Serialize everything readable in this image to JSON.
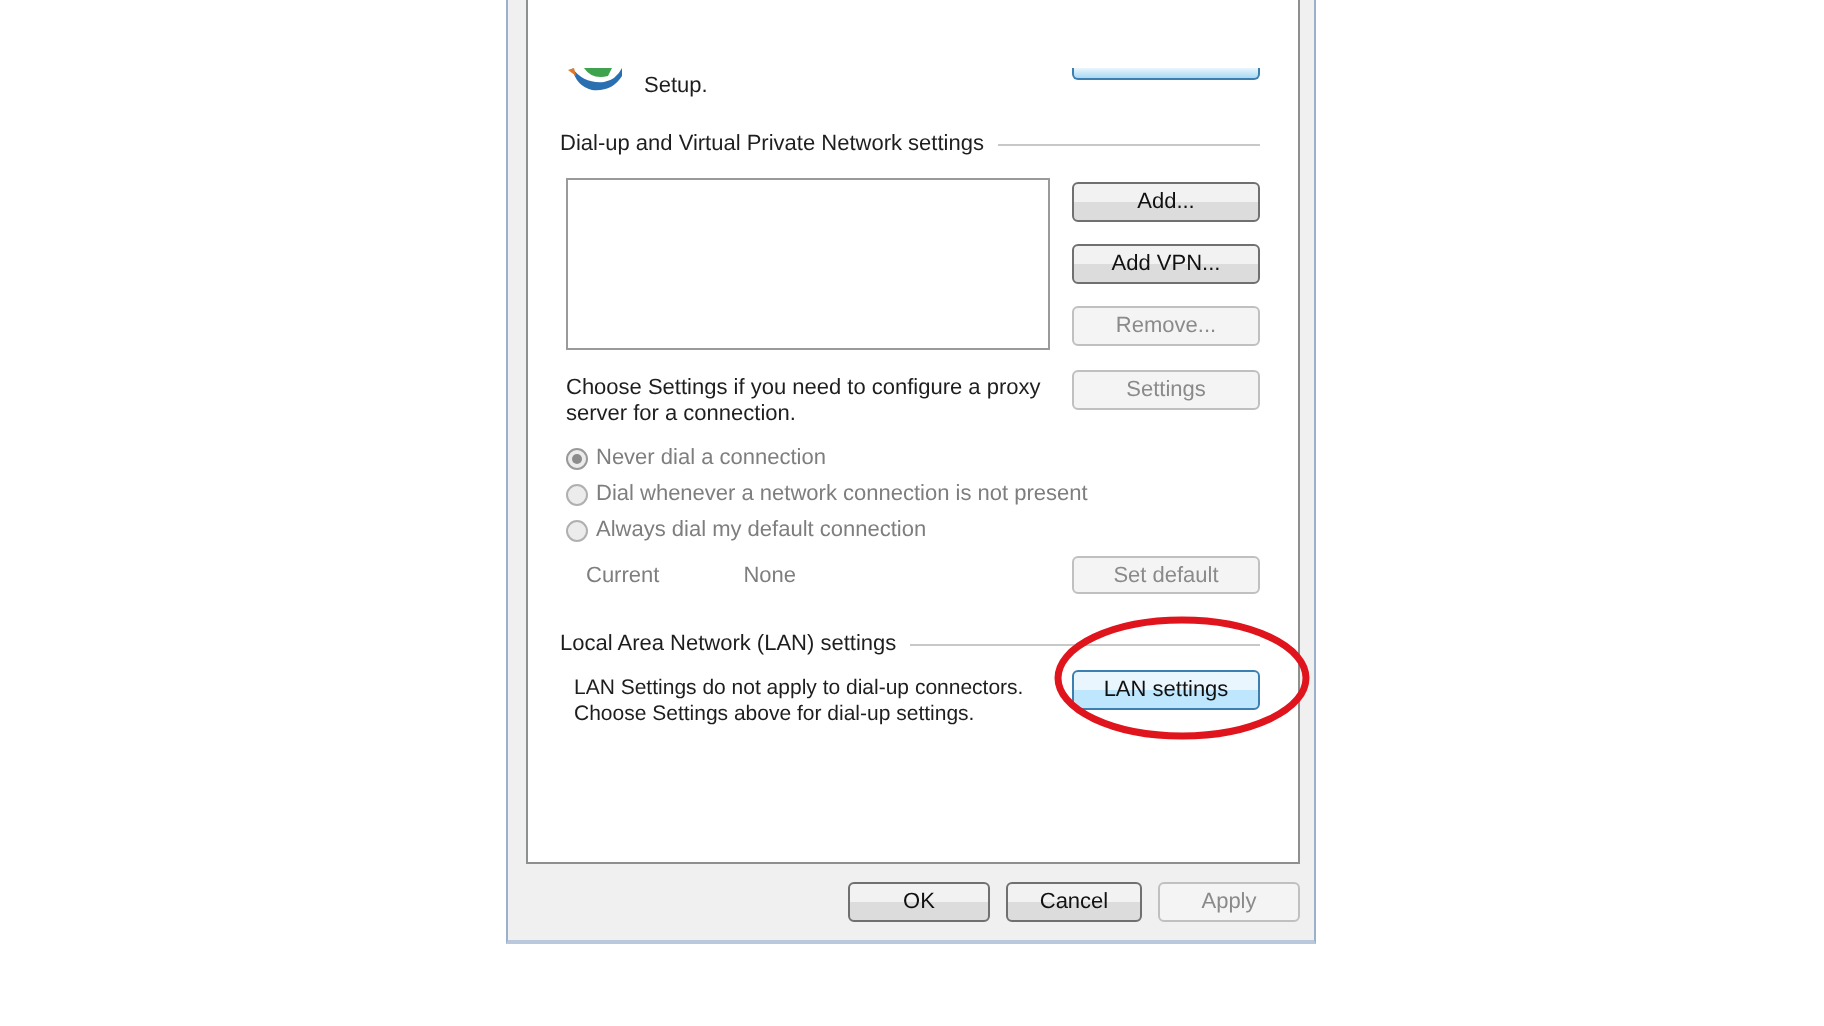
{
  "top_text": "Setup.",
  "vpn_group": {
    "title": "Dial-up and Virtual Private Network settings",
    "buttons": [
      {
        "label": "Add...",
        "disabled": false
      },
      {
        "label": "Add VPN...",
        "disabled": false
      },
      {
        "label": "Remove...",
        "disabled": true
      }
    ]
  },
  "proxy": {
    "lines": [
      "Choose Settings if you need to configure a proxy",
      "server for a connection."
    ],
    "button": {
      "label": "Settings",
      "disabled": true
    }
  },
  "dial_options": [
    {
      "label": "Never dial a connection",
      "selected": true,
      "disabled": true
    },
    {
      "label": "Dial whenever a network connection is not present",
      "selected": false,
      "disabled": true
    },
    {
      "label": "Always dial my default connection",
      "selected": false,
      "disabled": true
    }
  ],
  "current": {
    "label": "Current",
    "value": "None",
    "disabled": true
  },
  "set_default_button": {
    "label": "Set default",
    "disabled": true
  },
  "lan_group": {
    "title": "Local Area Network (LAN) settings",
    "lines": [
      "LAN Settings do not apply to dial-up connectors.",
      "Choose Settings above for dial-up settings."
    ],
    "button": {
      "label": "LAN settings",
      "highlighted": true
    }
  },
  "annotation": {
    "kind": "ellipse",
    "color": "#e0141c"
  },
  "footer_buttons": [
    {
      "label": "OK",
      "disabled": false
    },
    {
      "label": "Cancel",
      "disabled": false
    },
    {
      "label": "Apply",
      "disabled": true
    }
  ]
}
